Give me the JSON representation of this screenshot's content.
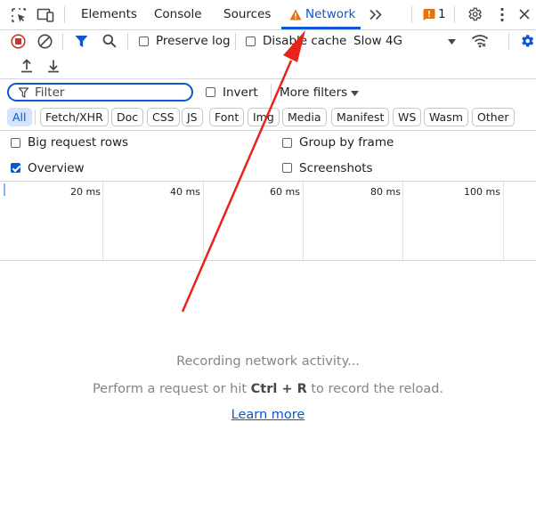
{
  "tabs": [
    {
      "label": "Elements"
    },
    {
      "label": "Console"
    },
    {
      "label": "Sources"
    },
    {
      "label": "Network",
      "active": true,
      "warning": true
    }
  ],
  "issues_count": "1",
  "toolbar": {
    "preserve_log": "Preserve log",
    "disable_cache": "Disable cache",
    "throttle": "Slow 4G"
  },
  "filter": {
    "placeholder": "Filter",
    "invert": "Invert",
    "more_filters": "More filters"
  },
  "type_filters": [
    "All",
    "Fetch/XHR",
    "Doc",
    "CSS",
    "JS",
    "Font",
    "Img",
    "Media",
    "Manifest",
    "WS",
    "Wasm",
    "Other"
  ],
  "options": {
    "big_request_rows": "Big request rows",
    "group_by_frame": "Group by frame",
    "overview": "Overview",
    "screenshots": "Screenshots"
  },
  "overview_ticks": [
    "20 ms",
    "40 ms",
    "60 ms",
    "80 ms",
    "100 ms"
  ],
  "empty_state": {
    "recording": "Recording network activity...",
    "hint_before": "Perform a request or hit ",
    "hint_keys": "Ctrl + R",
    "hint_after": " to record the reload.",
    "learn_more": "Learn more"
  },
  "colors": {
    "accent": "#0b57d0",
    "record_red": "#d93025",
    "warning_orange": "#e8710a",
    "annotation_arrow": "#e8231c"
  }
}
